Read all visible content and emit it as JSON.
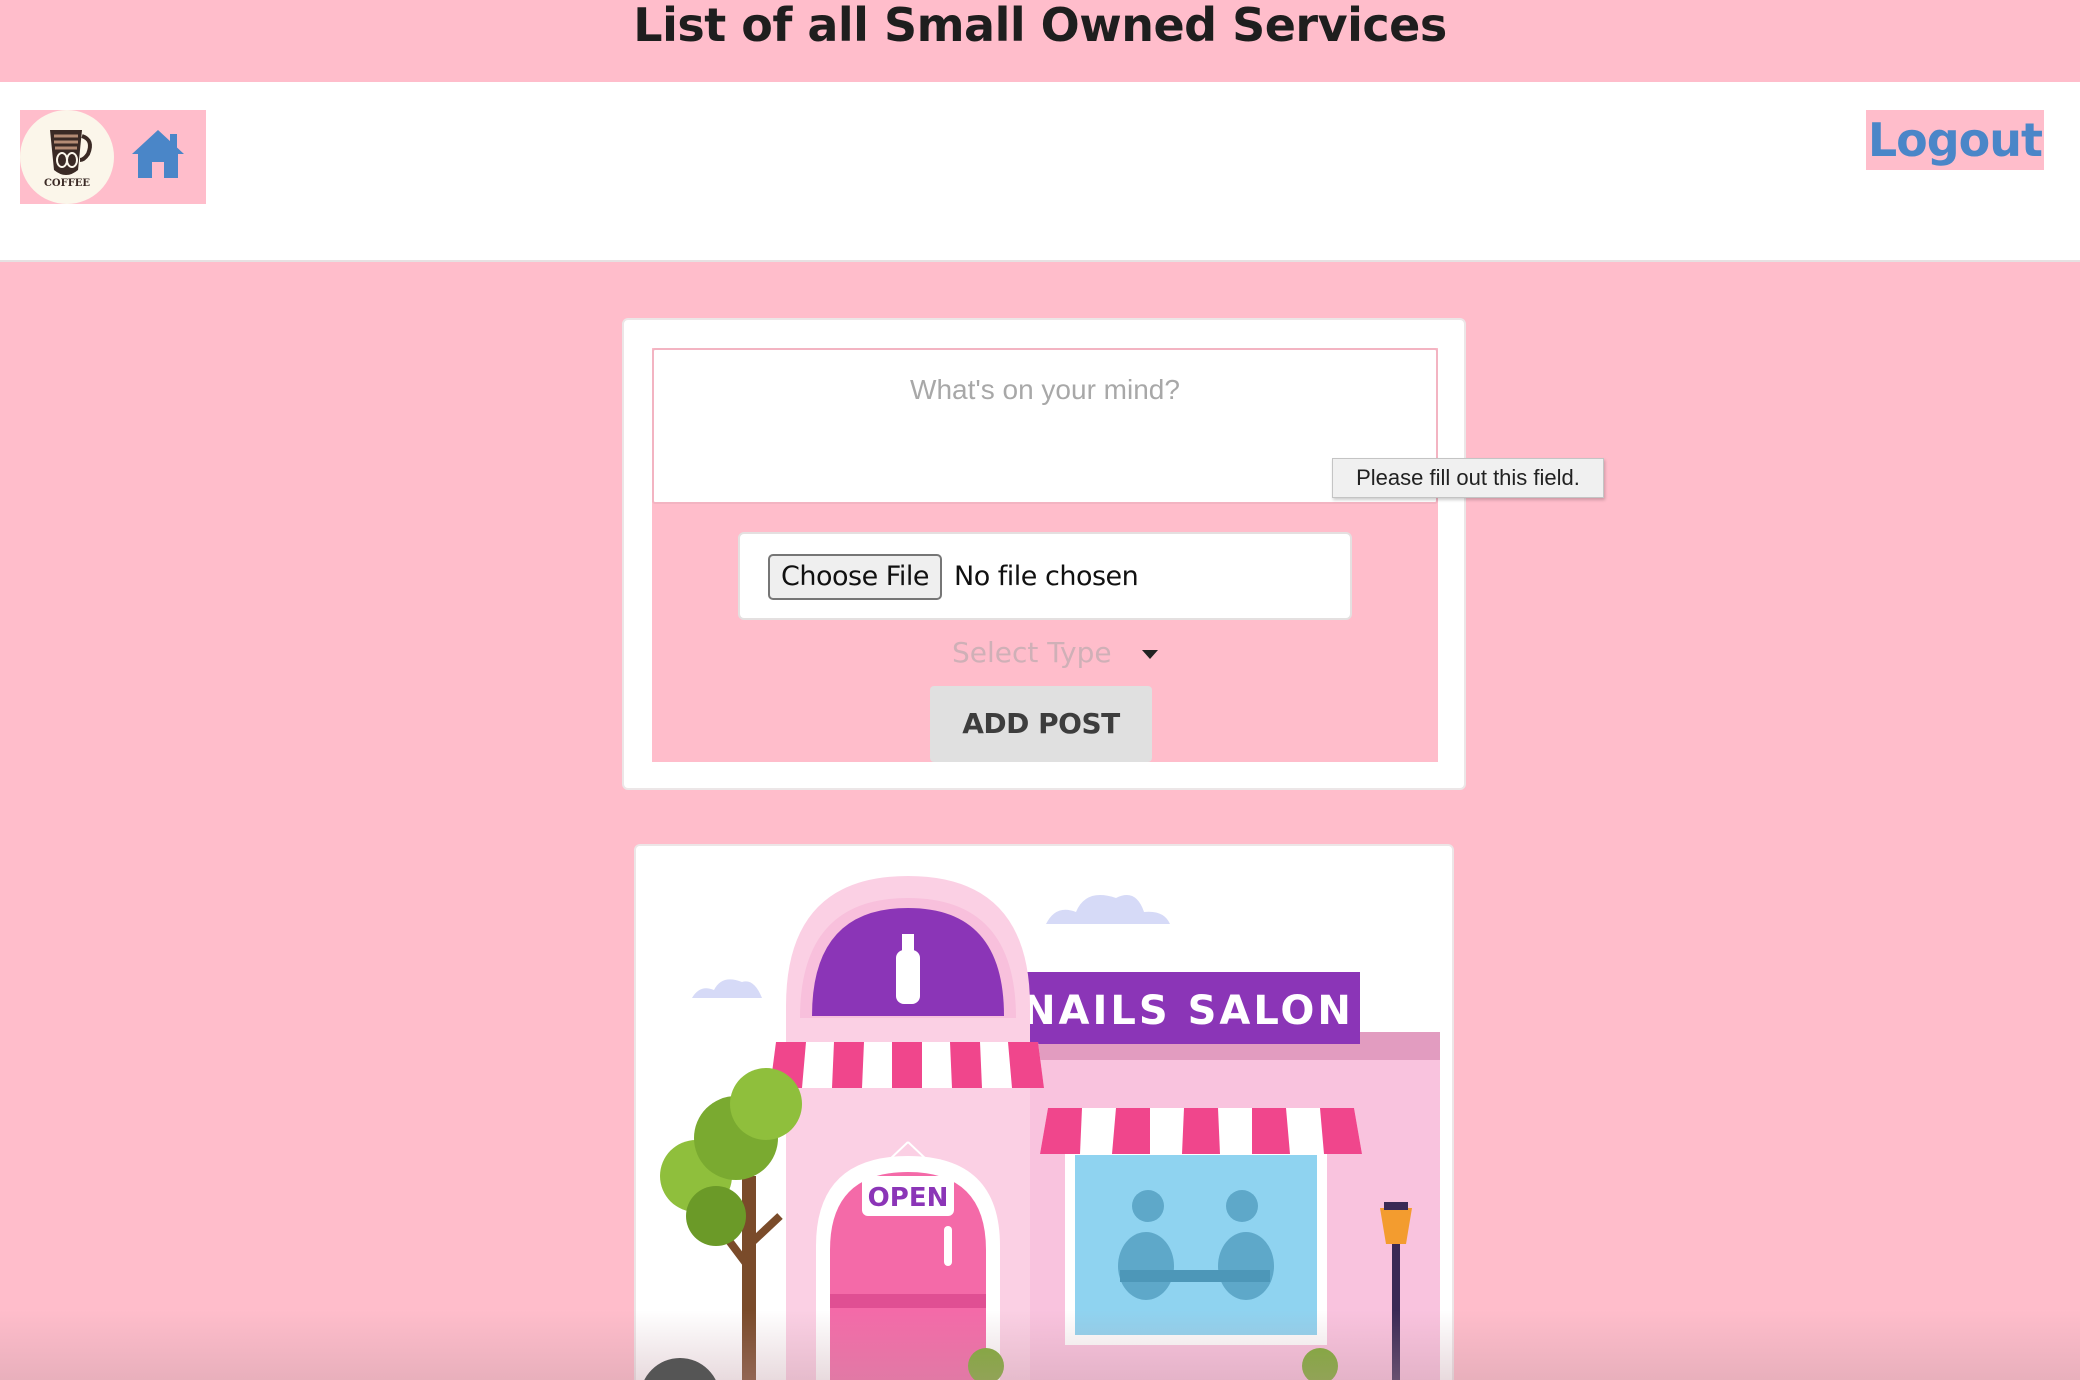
{
  "header": {
    "title": "List of all Small Owned Services"
  },
  "navbar": {
    "logo_text": "COFFEE",
    "home_icon": "home-icon",
    "logout_label": "Logout"
  },
  "post_form": {
    "textarea_placeholder": "What's on your mind?",
    "choose_file_label": "Choose File",
    "file_status": "No file chosen",
    "select_type_placeholder": "Select Type",
    "add_post_label": "ADD POST",
    "validation_tooltip": "Please fill out this field."
  },
  "feed": {
    "post_image": {
      "sign_text": "NAILS SALON",
      "door_sign": "OPEN"
    }
  },
  "colors": {
    "page_bg": "#ffbdcb",
    "link_blue": "#4a86c8",
    "salon_purple": "#7b2fa8",
    "salon_pink": "#f46aa8"
  }
}
